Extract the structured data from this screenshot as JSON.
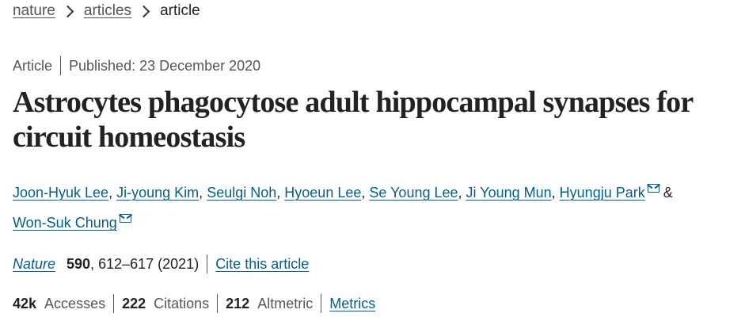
{
  "breadcrumb": {
    "items": [
      "nature",
      "articles"
    ],
    "current": "article"
  },
  "meta": {
    "type": "Article",
    "published": "Published: 23 December 2020"
  },
  "title": "Astrocytes phagocytose adult hippocampal synapses for circuit homeostasis",
  "authors": [
    "Joon-Hyuk Lee",
    "Ji-young Kim",
    "Seulgi Noh",
    "Hyoeun Lee",
    "Se Young Lee",
    "Ji Young Mun",
    "Hyungju Park",
    "Won-Suk Chung"
  ],
  "authors_separator": ",",
  "authors_and": "&",
  "citation": {
    "journal": "Nature",
    "volume": "590",
    "pages_year": ", 612–617 (2021)",
    "cite_label": "Cite this article"
  },
  "metrics": {
    "accesses_value": "42k",
    "accesses_label": "Accesses",
    "citations_value": "222",
    "citations_label": "Citations",
    "altmetric_value": "212",
    "altmetric_label": "Altmetric",
    "metrics_link": "Metrics"
  },
  "icons": {
    "breadcrumb_separator": "chevron-right-icon",
    "corresponding_author": "mail-icon"
  },
  "colors": {
    "link": "#025e8d",
    "text": "#222222",
    "muted": "#555555"
  }
}
